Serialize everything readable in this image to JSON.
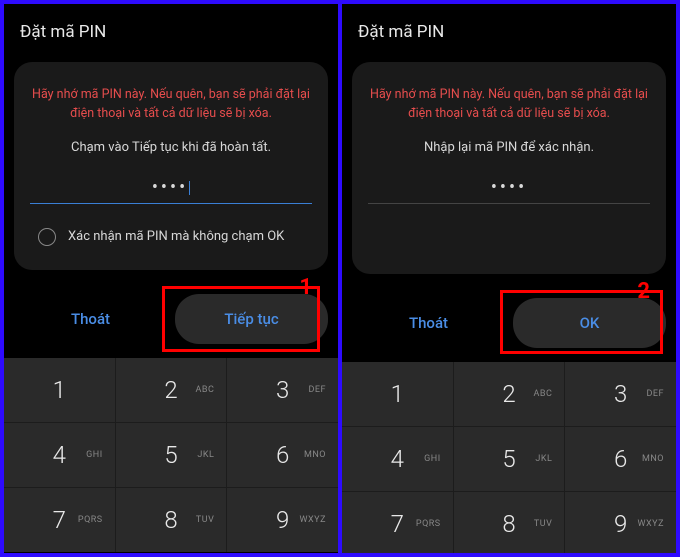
{
  "screen1": {
    "title": "Đặt mã PIN",
    "warning": "Hãy nhớ mã PIN này. Nếu quên, bạn sẽ phải đặt lại điện thoại và tất cả dữ liệu sẽ bị xóa.",
    "instruction": "Chạm vào Tiếp tục khi đã hoàn tất.",
    "pin_dots": "••••",
    "checkbox_label": "Xác nhận mã PIN mà không chạm OK",
    "step": "1",
    "exit_button": "Thoát",
    "continue_button": "Tiếp tục"
  },
  "screen2": {
    "title": "Đặt mã PIN",
    "warning": "Hãy nhớ mã PIN này. Nếu quên, bạn sẽ phải đặt lại điện thoại và tất cả dữ liệu sẽ bị xóa.",
    "instruction": "Nhập lại mã PIN để xác nhận.",
    "pin_dots": "••••",
    "step": "2",
    "exit_button": "Thoát",
    "ok_button": "OK"
  },
  "keypad": {
    "keys": [
      {
        "num": "1",
        "letters": ""
      },
      {
        "num": "2",
        "letters": "ABC"
      },
      {
        "num": "3",
        "letters": "DEF"
      },
      {
        "num": "4",
        "letters": "GHI"
      },
      {
        "num": "5",
        "letters": "JKL"
      },
      {
        "num": "6",
        "letters": "MNO"
      },
      {
        "num": "7",
        "letters": "PQRS"
      },
      {
        "num": "8",
        "letters": "TUV"
      },
      {
        "num": "9",
        "letters": "WXYZ"
      }
    ]
  }
}
